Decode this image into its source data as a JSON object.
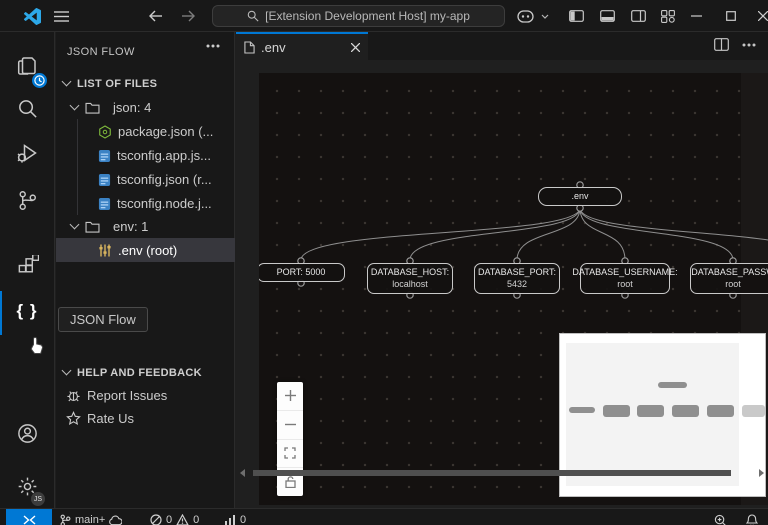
{
  "titlebar": {
    "command_center_text": "[Extension Development Host] my-app"
  },
  "activity_bar": {
    "braces_glyph": "{ }",
    "js_badge": "JS"
  },
  "sidebar": {
    "title": "JSON FLOW",
    "list_header": "LIST OF FILES",
    "tree": [
      {
        "label": "json: 4"
      },
      {
        "label": "package.json (..."
      },
      {
        "label": "tsconfig.app.js..."
      },
      {
        "label": "tsconfig.json (r..."
      },
      {
        "label": "tsconfig.node.j..."
      },
      {
        "label": "env: 1"
      },
      {
        "label": ".env (root)"
      }
    ],
    "tooltip": "JSON Flow",
    "help_header": "HELP AND FEEDBACK",
    "help_items": [
      {
        "label": "Report Issues"
      },
      {
        "label": "Rate Us"
      }
    ]
  },
  "editor": {
    "tab_label": ".env",
    "flow": {
      "root_label": ".env",
      "nodes": [
        {
          "line1": "PORT: 5000",
          "line2": ""
        },
        {
          "line1": "DATABASE_HOST:",
          "line2": "localhost"
        },
        {
          "line1": "DATABASE_PORT:",
          "line2": "5432"
        },
        {
          "line1": "DATABASE_USERNAME:",
          "line2": "root"
        },
        {
          "line1": "DATABASE_PASSW",
          "line2": "root"
        }
      ]
    }
  },
  "status_bar": {
    "branch": "main+",
    "errors": "0",
    "warnings": "0",
    "ports": "0"
  },
  "colors": {
    "accent": "#0078d4",
    "canvas_bg": "#141110",
    "node_border": "#c9c9c9",
    "list_selection": "#37373d"
  }
}
